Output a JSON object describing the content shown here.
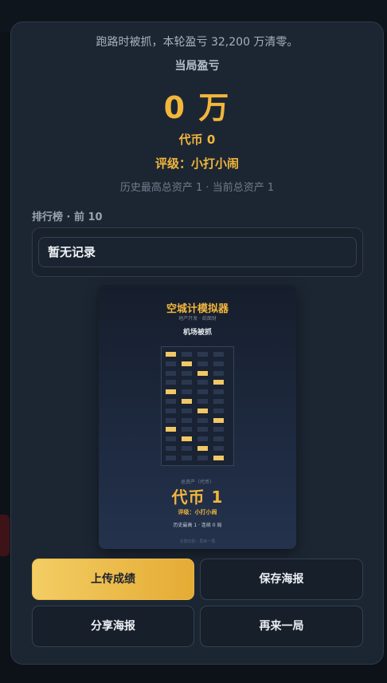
{
  "result": {
    "message": "跑路时被抓，本轮盈亏 32,200 万清零。",
    "pnl_label": "当局盈亏",
    "pnl_value": "0 万",
    "coins": "代币 0",
    "rating": "评级：小打小闹",
    "history": "历史最高总资产 1 · 当前总资产 1"
  },
  "leaderboard": {
    "title": "排行榜 · 前 10",
    "empty_text": "暂无记录"
  },
  "poster": {
    "title": "空城计模拟器",
    "subtitle": "地产开发 · 纸面财",
    "event": "机场被抓",
    "asset_label": "总资产（代币）",
    "asset_value": "代币 1",
    "rating": "评级：小打小闹",
    "stats": "历史最高 1 · 连续 0 局",
    "footer": "长按识别 · 再来一局"
  },
  "buttons": {
    "upload": "上传成绩",
    "save_poster": "保存海报",
    "share_poster": "分享海报",
    "play_again": "再来一局"
  },
  "colors": {
    "accent": "#f2b63c",
    "modal_bg": "#1c2633",
    "page_bg": "#0d1218"
  }
}
